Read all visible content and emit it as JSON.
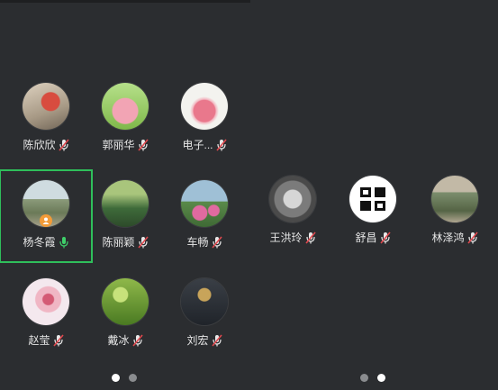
{
  "left_page": {
    "participants": [
      {
        "name": "陈欣欣",
        "mic": "muted",
        "avatar": "flowers-photo",
        "colors": [
          "#c9b7a0",
          "#d84c3f"
        ]
      },
      {
        "name": "郭丽华",
        "mic": "muted",
        "avatar": "cartoon-pig",
        "colors": [
          "#9ad06a",
          "#f2a4b4"
        ]
      },
      {
        "name": "电子...",
        "mic": "muted",
        "avatar": "rose-drawing",
        "colors": [
          "#f3f3ef",
          "#e9788c"
        ]
      },
      {
        "name": "杨冬霞",
        "mic": "on",
        "avatar": "landscape-photo",
        "colors": [
          "#8a9a7a",
          "#d9e3e6"
        ],
        "host": true,
        "active": true
      },
      {
        "name": "陈丽颖",
        "mic": "muted",
        "avatar": "bamboo-garden",
        "colors": [
          "#3e6b3a",
          "#a9c57c"
        ]
      },
      {
        "name": "车畅",
        "mic": "muted",
        "avatar": "pink-flowers",
        "colors": [
          "#9fc0d6",
          "#e06aa0"
        ]
      },
      {
        "name": "赵莹",
        "mic": "muted",
        "avatar": "pink-swirl",
        "colors": [
          "#f4e8ee",
          "#d45a74"
        ]
      },
      {
        "name": "戴冰",
        "mic": "muted",
        "avatar": "green-sprout",
        "colors": [
          "#5a8a2a",
          "#c7e27b"
        ]
      },
      {
        "name": "刘宏",
        "mic": "muted",
        "avatar": "night-scene",
        "colors": [
          "#20242a",
          "#c8a45a"
        ]
      }
    ],
    "page_indicator": {
      "count": 2,
      "current": 0
    }
  },
  "right_page": {
    "participants": [
      {
        "name": "王洪玲",
        "mic": "muted",
        "avatar": "bw-photo",
        "colors": [
          "#7b7b7b",
          "#d6d6d6"
        ]
      },
      {
        "name": "舒昌",
        "mic": "muted",
        "avatar": "calligraphy-logo",
        "colors": [
          "#ffffff",
          "#111111"
        ]
      },
      {
        "name": "林泽鸿",
        "mic": "muted",
        "avatar": "street-photo",
        "colors": [
          "#7c8e6d",
          "#c2b9a6"
        ]
      }
    ],
    "page_indicator": {
      "count": 2,
      "current": 1
    }
  },
  "colors": {
    "active_border": "#2fbf5b",
    "mic_on": "#3fcf6a",
    "mic_muted_slash": "#e0484e",
    "host_badge": "#f29b38"
  }
}
